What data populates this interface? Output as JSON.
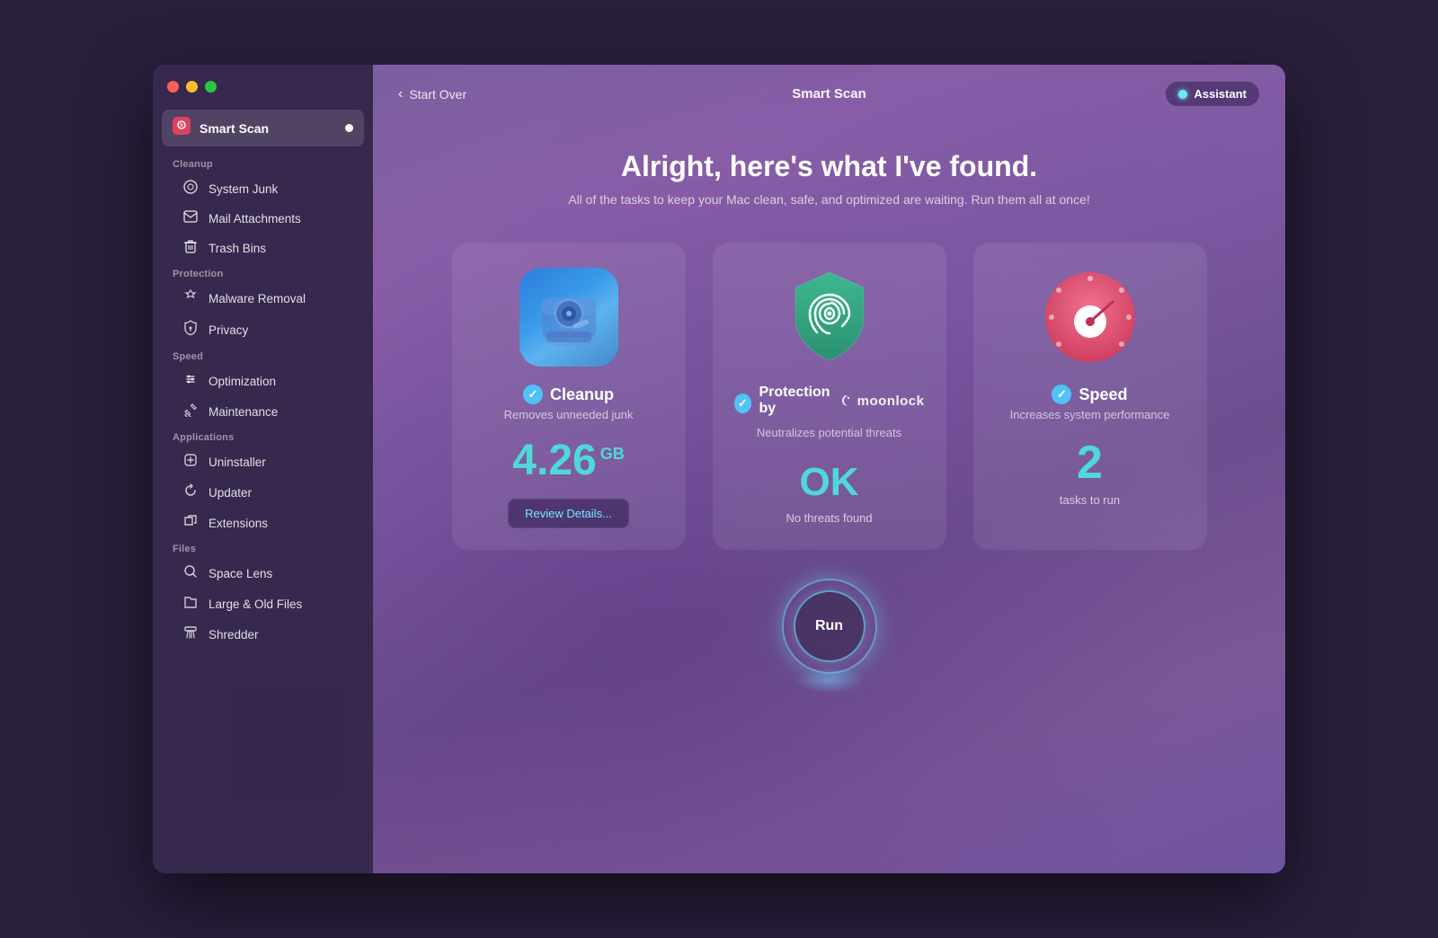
{
  "window": {
    "title": "Smart Scan"
  },
  "topbar": {
    "back_label": "Start Over",
    "title": "Smart Scan",
    "assistant_label": "Assistant"
  },
  "hero": {
    "title": "Alright, here's what I've found.",
    "subtitle": "All of the tasks to keep your Mac clean, safe, and optimized are waiting. Run them all at once!"
  },
  "cards": [
    {
      "id": "cleanup",
      "title": "Cleanup",
      "subtitle": "Removes unneeded junk",
      "value": "4.26",
      "unit": "GB",
      "bottom_label": "",
      "button_label": "Review Details..."
    },
    {
      "id": "protection",
      "title": "Protection by",
      "brand": "moonlock",
      "subtitle": "Neutralizes potential threats",
      "value": "OK",
      "bottom_label": "No threats found"
    },
    {
      "id": "speed",
      "title": "Speed",
      "subtitle": "Increases system performance",
      "value": "2",
      "bottom_label": "tasks to run"
    }
  ],
  "run_button": {
    "label": "Run"
  },
  "sidebar": {
    "active_item": {
      "label": "Smart Scan",
      "icon": "🔴"
    },
    "sections": [
      {
        "label": "Cleanup",
        "items": [
          {
            "label": "System Junk",
            "icon": "⚙"
          },
          {
            "label": "Mail Attachments",
            "icon": "✉"
          },
          {
            "label": "Trash Bins",
            "icon": "🗑"
          }
        ]
      },
      {
        "label": "Protection",
        "items": [
          {
            "label": "Malware Removal",
            "icon": "✳"
          },
          {
            "label": "Privacy",
            "icon": "✋"
          }
        ]
      },
      {
        "label": "Speed",
        "items": [
          {
            "label": "Optimization",
            "icon": "⇅"
          },
          {
            "label": "Maintenance",
            "icon": "🔧"
          }
        ]
      },
      {
        "label": "Applications",
        "items": [
          {
            "label": "Uninstaller",
            "icon": "⊠"
          },
          {
            "label": "Updater",
            "icon": "↺"
          },
          {
            "label": "Extensions",
            "icon": "⇥"
          }
        ]
      },
      {
        "label": "Files",
        "items": [
          {
            "label": "Space Lens",
            "icon": "◎"
          },
          {
            "label": "Large & Old Files",
            "icon": "📁"
          },
          {
            "label": "Shredder",
            "icon": "▤"
          }
        ]
      }
    ]
  }
}
